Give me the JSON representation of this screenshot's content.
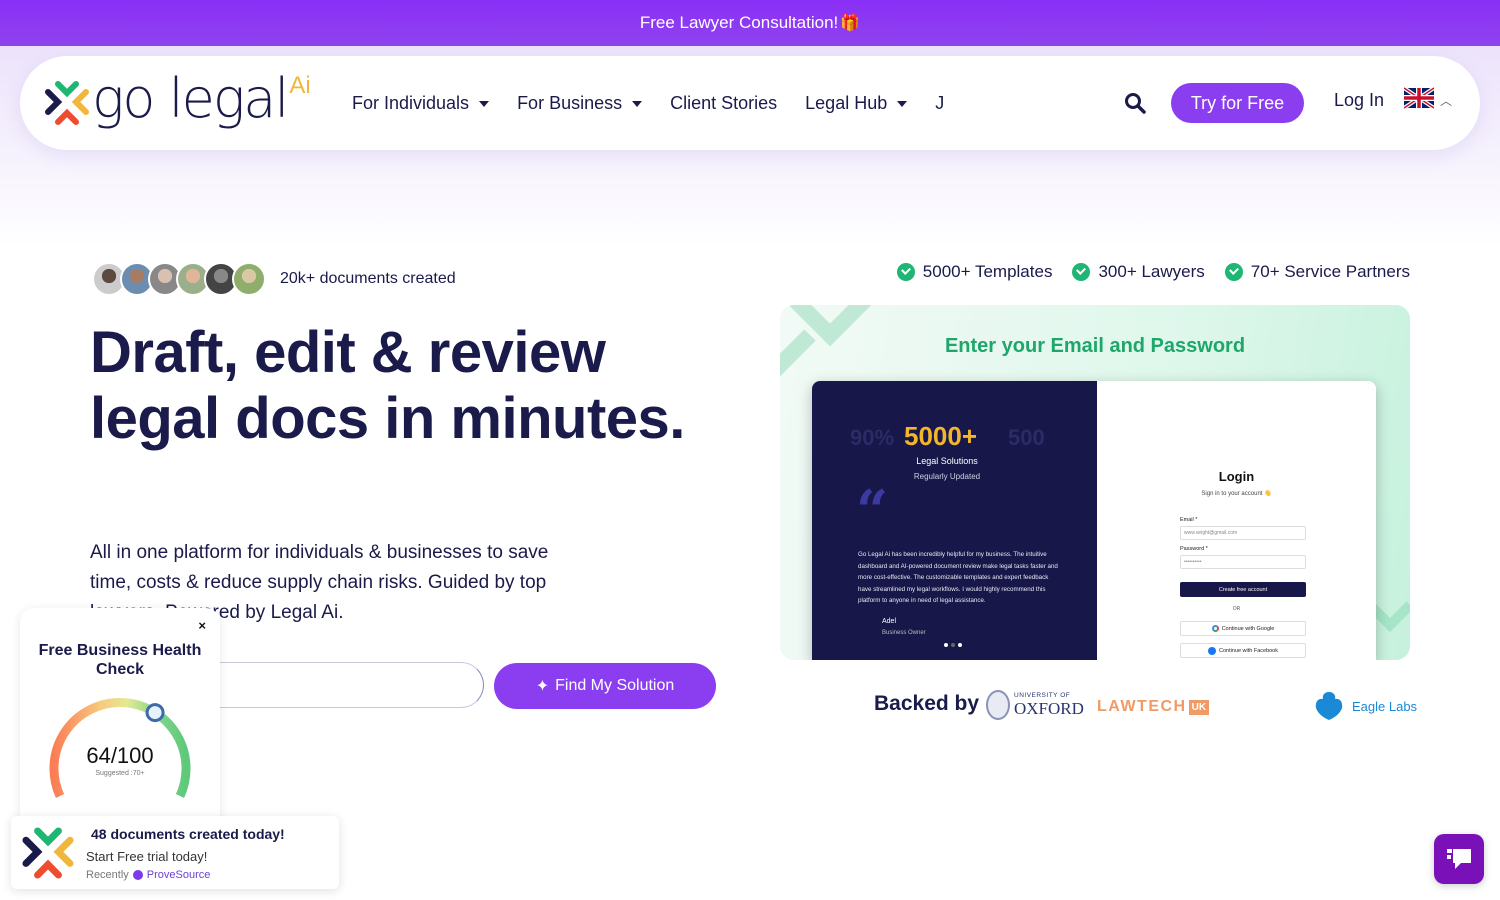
{
  "promo": {
    "text": "Free Lawyer Consultation!",
    "icon": "gift-icon",
    "emoji": "🎁"
  },
  "brand": {
    "name": "go legal",
    "suffix": "Ai",
    "accent": "#8a3ef0",
    "green": "#1fb573",
    "navy": "#1a1a4b",
    "yellow": "#f1b73c"
  },
  "nav": {
    "items": [
      {
        "label": "For Individuals",
        "dropdown": true
      },
      {
        "label": "For Business",
        "dropdown": true
      },
      {
        "label": "Client Stories",
        "dropdown": false
      },
      {
        "label": "Legal Hub",
        "dropdown": true
      },
      {
        "label": "J",
        "dropdown": false
      }
    ],
    "search_icon": "search-icon",
    "try_label": "Try for Free",
    "login_label": "Log In",
    "language": "UK flag"
  },
  "hero": {
    "docs_created": "20k+ documents created",
    "features": [
      "5000+ Templates",
      "300+ Lawyers",
      "70+ Service Partners"
    ],
    "headline": "Draft, edit & review legal docs in minutes.",
    "subtext": "All in one platform for individuals & businesses to save time, costs & reduce supply chain risks. Guided by top lawyers. Powered by Legal Ai.",
    "input_value": "",
    "find_label": "Find My Solution"
  },
  "demo": {
    "title": "Enter your Email and Password",
    "stat_left_ghost": "90%",
    "stat_main": "5000+",
    "stat_right_ghost": "500",
    "stat_label": "Legal Solutions",
    "stat_sub": "Regularly Updated",
    "quote": "Go Legal Ai has been incredibly helpful for my business. The intuitive dashboard and AI-powered document review make legal tasks faster and more cost-effective. The customizable templates and expert feedback have streamlined my legal workflows. I would highly recommend this platform to anyone in need of legal assistance.",
    "quote_name": "Adel",
    "quote_role": "Business Owner",
    "login_title": "Login",
    "login_sub": "Sign in to your account 👋",
    "email_label": "Email *",
    "email_value": "www.wright@gmail.com",
    "password_label": "Password *",
    "password_value": "••••••••••",
    "create_label": "Create free account",
    "or_label": "OR",
    "google_label": "Continue with Google",
    "facebook_label": "Continue with Facebook"
  },
  "backed": {
    "label": "Backed by",
    "oxford_small": "UNIVERSITY OF",
    "oxford_big": "OXFORD",
    "lawtech": "LAWTECH",
    "lawtech_uk": "UK",
    "eagle": "Eagle Labs"
  },
  "health": {
    "close": "×",
    "title": "Free Business Health Check",
    "score": "64/100",
    "score_value": 64,
    "score_max": 100,
    "suggested": "Suggested :70+"
  },
  "toast": {
    "title": "48 documents created today!",
    "subtitle": "Start Free trial today!",
    "recency": "Recently",
    "source": "ProveSource"
  },
  "chat": {
    "icon": "chat-icon"
  }
}
